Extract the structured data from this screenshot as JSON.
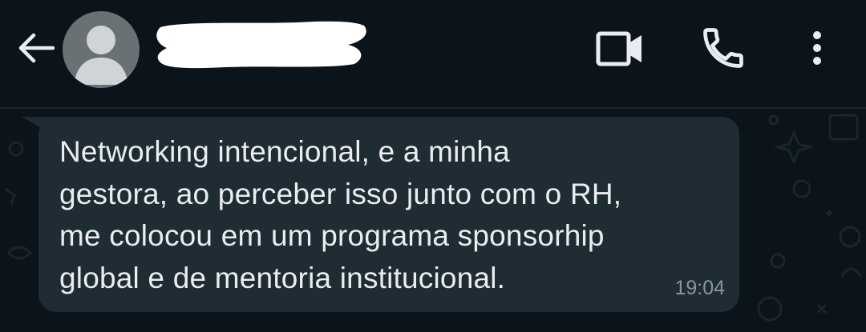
{
  "header": {
    "contact_name": "",
    "back_icon": "arrow-left-icon",
    "avatar_icon": "default-person-avatar-icon",
    "video_icon": "video-camera-icon",
    "call_icon": "phone-icon",
    "menu_icon": "more-vert-icon"
  },
  "message": {
    "text": "Networking intencional, e a minha\ngestora, ao perceber isso junto com o RH,\nme colocou em um programa sponsorhip\nglobal e de mentoria institucional.",
    "time": "19:04",
    "direction": "incoming"
  },
  "colors": {
    "header_bg": "#0b141a",
    "chat_bg": "#0b141a",
    "bubble_bg": "#1f2c34",
    "text": "#e9edef",
    "time": "#8696a0",
    "avatar_bg": "#6a7175",
    "avatar_fg": "#cfd4d6"
  }
}
